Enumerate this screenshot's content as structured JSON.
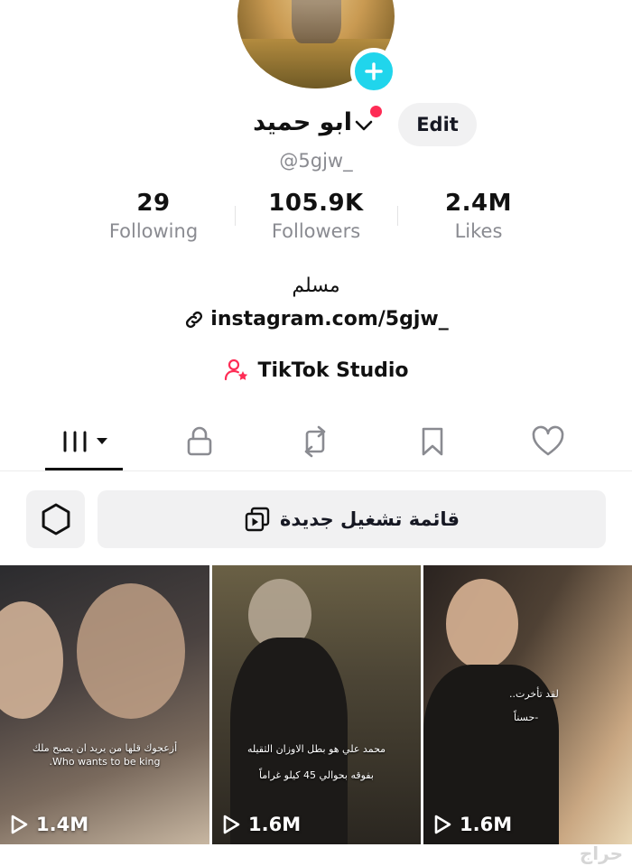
{
  "profile": {
    "display_name": "ابو حميد",
    "handle": "@5gjw_",
    "edit_label": "Edit",
    "bio": "مسلم",
    "link": "instagram.com/5gjw_",
    "studio_label": "TikTok Studio"
  },
  "stats": [
    {
      "value": "29",
      "label": "Following"
    },
    {
      "value": "105.9K",
      "label": "Followers"
    },
    {
      "value": "2.4M",
      "label": "Likes"
    }
  ],
  "tabs": [
    {
      "icon": "grid-icon",
      "selected": true
    },
    {
      "icon": "lock-icon",
      "selected": false
    },
    {
      "icon": "repost-icon",
      "selected": false
    },
    {
      "icon": "bookmark-icon",
      "selected": false
    },
    {
      "icon": "heart-icon",
      "selected": false
    }
  ],
  "playlist_button_label": "قائمة تشغيل جديدة",
  "videos": [
    {
      "views": "1.4M",
      "caption_ar": "أزعجوك قلها من يريد ان يصبح ملك",
      "caption_en": "Who wants to be king."
    },
    {
      "views": "1.6M",
      "caption_line1": "محمد علي هو بطل الاوزان الثقيله",
      "caption_line2": "بفوقه بحوالي 45 كيلو غراماً"
    },
    {
      "views": "1.6M",
      "caption_line1": "لقد تأخرت..",
      "caption_line2": "-حسناً"
    }
  ],
  "watermark": "حراج",
  "colors": {
    "accent_cyan": "#20d5ec",
    "accent_red": "#fe2c55",
    "muted_text": "#8a8b91",
    "button_bg": "#f1f1f2"
  }
}
